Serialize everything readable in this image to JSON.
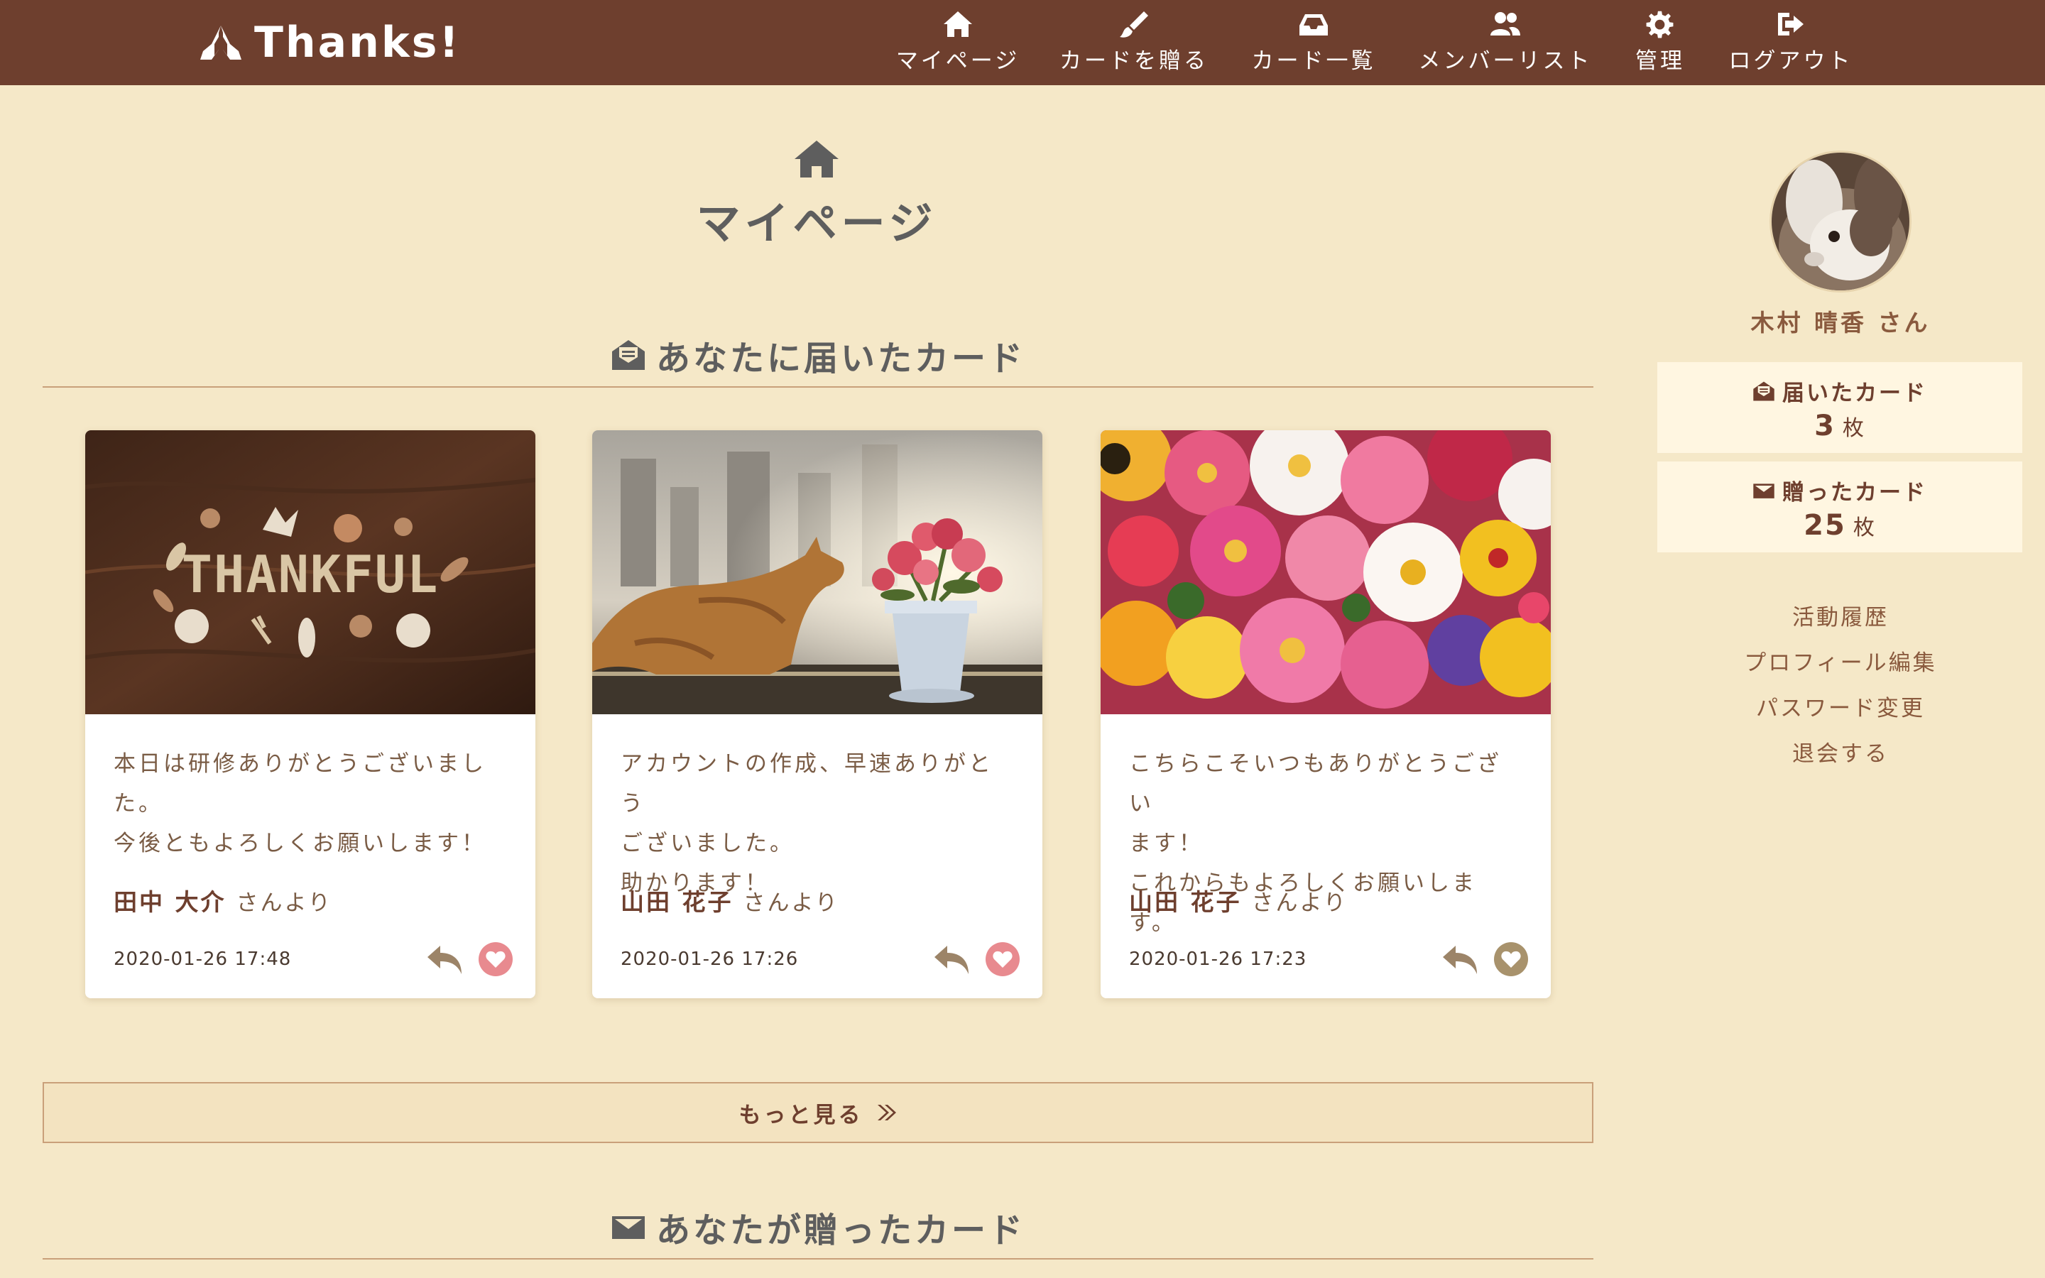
{
  "header": {
    "brand": "Thanks!",
    "nav": [
      {
        "label": "マイページ",
        "icon": "home-icon"
      },
      {
        "label": "カードを贈る",
        "icon": "brush-icon"
      },
      {
        "label": "カード一覧",
        "icon": "inbox-icon"
      },
      {
        "label": "メンバーリスト",
        "icon": "users-icon"
      },
      {
        "label": "管理",
        "icon": "gear-icon"
      },
      {
        "label": "ログアウト",
        "icon": "sign-out-icon"
      }
    ]
  },
  "main": {
    "page_title": "マイページ",
    "received_section_title": "あなたに届いたカード",
    "sent_section_title": "あなたが贈ったカード",
    "more_label": "もっと見る",
    "cards": [
      {
        "image_word": "THANKFUL",
        "message": "本日は研修ありがとうございまし\nた。\n今後ともよろしくお願いします！",
        "sender": "田中 大介",
        "sender_suffix": "さんより",
        "date": "2020-01-26 17:48",
        "liked": true
      },
      {
        "message": "アカウントの作成、早速ありがとう\nございました。\n助かります！",
        "sender": "山田 花子",
        "sender_suffix": "さんより",
        "date": "2020-01-26 17:26",
        "liked": true
      },
      {
        "message": "こちらこそいつもありがとうござい\nます！\nこれからもよろしくお願いします。",
        "sender": "山田 花子",
        "sender_suffix": "さんより",
        "date": "2020-01-26 17:23",
        "liked": false
      }
    ]
  },
  "sidebar": {
    "user_name": "木村 晴香 さん",
    "received_label": "届いたカード",
    "received_count": "3",
    "sent_label": "贈ったカード",
    "sent_count": "25",
    "unit": "枚",
    "links": [
      "活動履歴",
      "プロフィール編集",
      "パスワード変更",
      "退会する"
    ]
  },
  "colors": {
    "header_bg": "#6e3f2e",
    "page_bg": "#f5e8c8",
    "accent": "#6e3f2e",
    "like_active": "#e88a8f",
    "like_inactive": "#a8926c"
  }
}
